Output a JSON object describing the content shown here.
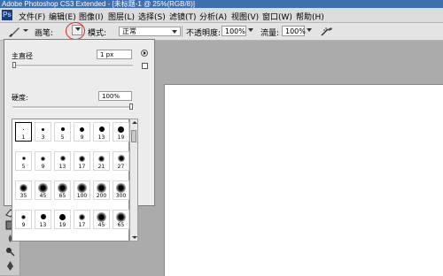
{
  "window": {
    "title": "Adobe Photoshop CS3 Extended - [未标题-1 @ 25%(RGB/8)]"
  },
  "menu": [
    {
      "label": "文件(F)"
    },
    {
      "label": "编辑(E)"
    },
    {
      "label": "图像(I)"
    },
    {
      "label": "图层(L)"
    },
    {
      "label": "选择(S)"
    },
    {
      "label": "滤镜(T)"
    },
    {
      "label": "分析(A)"
    },
    {
      "label": "视图(V)"
    },
    {
      "label": "窗口(W)"
    },
    {
      "label": "帮助(H)"
    }
  ],
  "options": {
    "brush_label": "画笔:",
    "brush_size": "1",
    "mode_label": "模式:",
    "mode_value": "正常",
    "opacity_label": "不透明度:",
    "opacity_value": "100%",
    "flow_label": "流量:",
    "flow_value": "100%"
  },
  "popup": {
    "diameter_label": "主直径",
    "diameter_value": "1 px",
    "hardness_label": "硬度:",
    "hardness_value": "100%",
    "diameter_fraction": 0.0,
    "hardness_fraction": 1.0
  },
  "brushes": [
    {
      "size": "1",
      "kind": "hard",
      "selected": true
    },
    {
      "size": "3",
      "kind": "hard"
    },
    {
      "size": "5",
      "kind": "hard"
    },
    {
      "size": "9",
      "kind": "hard"
    },
    {
      "size": "13",
      "kind": "hard"
    },
    {
      "size": "19",
      "kind": "hard"
    },
    {
      "size": "5",
      "kind": "soft"
    },
    {
      "size": "9",
      "kind": "soft"
    },
    {
      "size": "13",
      "kind": "soft"
    },
    {
      "size": "17",
      "kind": "soft"
    },
    {
      "size": "21",
      "kind": "soft"
    },
    {
      "size": "27",
      "kind": "soft"
    },
    {
      "size": "35",
      "kind": "soft"
    },
    {
      "size": "45",
      "kind": "soft"
    },
    {
      "size": "65",
      "kind": "soft"
    },
    {
      "size": "100",
      "kind": "soft"
    },
    {
      "size": "200",
      "kind": "soft"
    },
    {
      "size": "300",
      "kind": "soft"
    },
    {
      "size": "9",
      "kind": "soft"
    },
    {
      "size": "13",
      "kind": "hard"
    },
    {
      "size": "19",
      "kind": "hard"
    },
    {
      "size": "17",
      "kind": "soft"
    },
    {
      "size": "45",
      "kind": "soft"
    },
    {
      "size": "65",
      "kind": "soft"
    }
  ],
  "colors": {
    "highlight_circle": "#e22222",
    "title_bar": "#3e6fae"
  }
}
